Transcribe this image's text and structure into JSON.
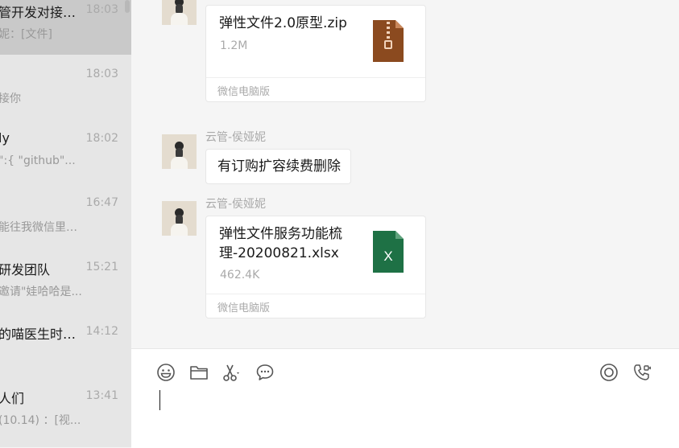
{
  "sidebar": {
    "conversations": [
      {
        "name": "管开发对接…",
        "time": "18:03",
        "preview": "妮：[文件]",
        "active": true
      },
      {
        "name": "",
        "time": "18:03",
        "preview": "接你"
      },
      {
        "name": "ly",
        "time": "18:02",
        "preview": "\":{ \"github\"..."
      },
      {
        "name": "",
        "time": "16:47",
        "preview": "能往我微信里发..."
      },
      {
        "name": "研发团队",
        "time": "15:21",
        "preview": "邀请\"娃哈哈是..."
      },
      {
        "name": "的喵医生时…",
        "time": "14:12",
        "preview": ""
      },
      {
        "name": "人们",
        "time": "13:41",
        "preview": "(10.14) ：[视..."
      }
    ]
  },
  "chat": {
    "messages": [
      {
        "type": "file",
        "file_name": "弹性文件2.0原型.zip",
        "file_size": "1.2M",
        "source": "微信电脑版",
        "icon": "zip-file-icon",
        "icon_color": "#8b4a1f"
      },
      {
        "type": "text",
        "sender": "云管-侯娅妮",
        "text": "有订购扩容续费删除"
      },
      {
        "type": "file",
        "sender": "云管-侯娅妮",
        "file_name": "弹性文件服务功能梳理-20200821.xlsx",
        "file_size": "462.4K",
        "source": "微信电脑版",
        "icon": "excel-file-icon",
        "icon_color": "#1e7145",
        "icon_letter": "X"
      }
    ]
  },
  "toolbar": {
    "icons": [
      "emoji-icon",
      "folder-icon",
      "scissors-icon",
      "chat-bubble-icon",
      "live-icon",
      "video-call-icon"
    ]
  },
  "input": {
    "value": ""
  }
}
